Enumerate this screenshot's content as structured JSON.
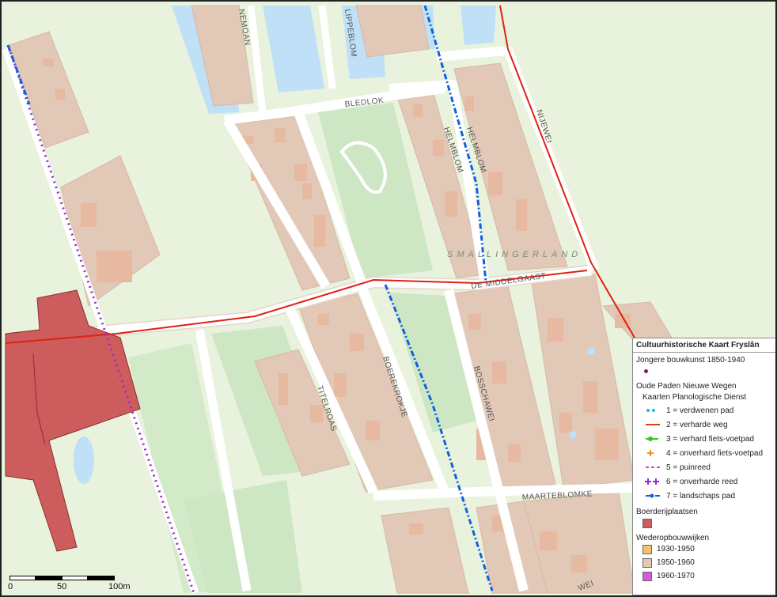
{
  "map": {
    "region_label": "SMALLINGERLAND",
    "streets": [
      "NEMOAN",
      "LIPPEBLOM",
      "BLEDLOK",
      "HELMBLOM",
      "HELMBLOM",
      "NIJEWEI",
      "DE MIDDELGAAST",
      "TITELROAS",
      "BOEREKROKJE",
      "BOSSCHAWEI",
      "MAARTEBLOMKE",
      "WEI"
    ]
  },
  "scale": {
    "labels": [
      "0",
      "50",
      "100m"
    ]
  },
  "legend": {
    "title": "Cultuurhistorische Kaart Fryslân",
    "section1": "Jongere bouwkunst 1850-1940",
    "section2": "Oude Paden Nieuwe Wegen",
    "subsection2": "Kaarten Planologische Dienst",
    "paths": [
      {
        "label": "1 = verdwenen pad",
        "color": "#1fb8d8",
        "style": "dots"
      },
      {
        "label": "2 = verharde weg",
        "color": "#d8401c",
        "style": "line"
      },
      {
        "label": "3 = verhard fiets-voetpad",
        "color": "#38c020",
        "style": "dotline"
      },
      {
        "label": "4 = onverhard fiets-voetpad",
        "color": "#f09020",
        "style": "plus"
      },
      {
        "label": "5 = puinreed",
        "color": "#d040d0",
        "style": "dash"
      },
      {
        "label": "6 = onverharde reed",
        "color": "#9a28d8",
        "style": "plus2"
      },
      {
        "label": "7 = landschaps pad",
        "color": "#1060e0",
        "style": "dashdot"
      }
    ],
    "section3": "Boerderijplaatsen",
    "farm_color": "#cd5c5c",
    "section4": "Wederopbouwwijken",
    "periods": [
      {
        "label": "1930-1950",
        "color": "#f2c46a"
      },
      {
        "label": "1950-1960",
        "color": "#e2c8b6"
      },
      {
        "label": "1960-1970",
        "color": "#d45ad8"
      }
    ],
    "jongere_color": "#8a1a6a"
  }
}
